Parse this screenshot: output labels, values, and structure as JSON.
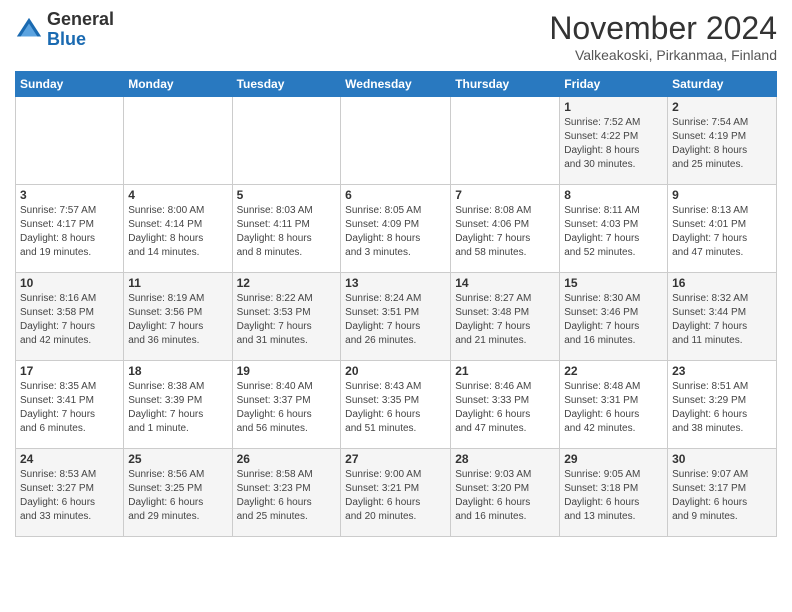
{
  "logo": {
    "general": "General",
    "blue": "Blue"
  },
  "header": {
    "month_title": "November 2024",
    "subtitle": "Valkeakoski, Pirkanmaa, Finland"
  },
  "weekdays": [
    "Sunday",
    "Monday",
    "Tuesday",
    "Wednesday",
    "Thursday",
    "Friday",
    "Saturday"
  ],
  "weeks": [
    [
      {
        "day": "",
        "detail": ""
      },
      {
        "day": "",
        "detail": ""
      },
      {
        "day": "",
        "detail": ""
      },
      {
        "day": "",
        "detail": ""
      },
      {
        "day": "",
        "detail": ""
      },
      {
        "day": "1",
        "detail": "Sunrise: 7:52 AM\nSunset: 4:22 PM\nDaylight: 8 hours\nand 30 minutes."
      },
      {
        "day": "2",
        "detail": "Sunrise: 7:54 AM\nSunset: 4:19 PM\nDaylight: 8 hours\nand 25 minutes."
      }
    ],
    [
      {
        "day": "3",
        "detail": "Sunrise: 7:57 AM\nSunset: 4:17 PM\nDaylight: 8 hours\nand 19 minutes."
      },
      {
        "day": "4",
        "detail": "Sunrise: 8:00 AM\nSunset: 4:14 PM\nDaylight: 8 hours\nand 14 minutes."
      },
      {
        "day": "5",
        "detail": "Sunrise: 8:03 AM\nSunset: 4:11 PM\nDaylight: 8 hours\nand 8 minutes."
      },
      {
        "day": "6",
        "detail": "Sunrise: 8:05 AM\nSunset: 4:09 PM\nDaylight: 8 hours\nand 3 minutes."
      },
      {
        "day": "7",
        "detail": "Sunrise: 8:08 AM\nSunset: 4:06 PM\nDaylight: 7 hours\nand 58 minutes."
      },
      {
        "day": "8",
        "detail": "Sunrise: 8:11 AM\nSunset: 4:03 PM\nDaylight: 7 hours\nand 52 minutes."
      },
      {
        "day": "9",
        "detail": "Sunrise: 8:13 AM\nSunset: 4:01 PM\nDaylight: 7 hours\nand 47 minutes."
      }
    ],
    [
      {
        "day": "10",
        "detail": "Sunrise: 8:16 AM\nSunset: 3:58 PM\nDaylight: 7 hours\nand 42 minutes."
      },
      {
        "day": "11",
        "detail": "Sunrise: 8:19 AM\nSunset: 3:56 PM\nDaylight: 7 hours\nand 36 minutes."
      },
      {
        "day": "12",
        "detail": "Sunrise: 8:22 AM\nSunset: 3:53 PM\nDaylight: 7 hours\nand 31 minutes."
      },
      {
        "day": "13",
        "detail": "Sunrise: 8:24 AM\nSunset: 3:51 PM\nDaylight: 7 hours\nand 26 minutes."
      },
      {
        "day": "14",
        "detail": "Sunrise: 8:27 AM\nSunset: 3:48 PM\nDaylight: 7 hours\nand 21 minutes."
      },
      {
        "day": "15",
        "detail": "Sunrise: 8:30 AM\nSunset: 3:46 PM\nDaylight: 7 hours\nand 16 minutes."
      },
      {
        "day": "16",
        "detail": "Sunrise: 8:32 AM\nSunset: 3:44 PM\nDaylight: 7 hours\nand 11 minutes."
      }
    ],
    [
      {
        "day": "17",
        "detail": "Sunrise: 8:35 AM\nSunset: 3:41 PM\nDaylight: 7 hours\nand 6 minutes."
      },
      {
        "day": "18",
        "detail": "Sunrise: 8:38 AM\nSunset: 3:39 PM\nDaylight: 7 hours\nand 1 minute."
      },
      {
        "day": "19",
        "detail": "Sunrise: 8:40 AM\nSunset: 3:37 PM\nDaylight: 6 hours\nand 56 minutes."
      },
      {
        "day": "20",
        "detail": "Sunrise: 8:43 AM\nSunset: 3:35 PM\nDaylight: 6 hours\nand 51 minutes."
      },
      {
        "day": "21",
        "detail": "Sunrise: 8:46 AM\nSunset: 3:33 PM\nDaylight: 6 hours\nand 47 minutes."
      },
      {
        "day": "22",
        "detail": "Sunrise: 8:48 AM\nSunset: 3:31 PM\nDaylight: 6 hours\nand 42 minutes."
      },
      {
        "day": "23",
        "detail": "Sunrise: 8:51 AM\nSunset: 3:29 PM\nDaylight: 6 hours\nand 38 minutes."
      }
    ],
    [
      {
        "day": "24",
        "detail": "Sunrise: 8:53 AM\nSunset: 3:27 PM\nDaylight: 6 hours\nand 33 minutes."
      },
      {
        "day": "25",
        "detail": "Sunrise: 8:56 AM\nSunset: 3:25 PM\nDaylight: 6 hours\nand 29 minutes."
      },
      {
        "day": "26",
        "detail": "Sunrise: 8:58 AM\nSunset: 3:23 PM\nDaylight: 6 hours\nand 25 minutes."
      },
      {
        "day": "27",
        "detail": "Sunrise: 9:00 AM\nSunset: 3:21 PM\nDaylight: 6 hours\nand 20 minutes."
      },
      {
        "day": "28",
        "detail": "Sunrise: 9:03 AM\nSunset: 3:20 PM\nDaylight: 6 hours\nand 16 minutes."
      },
      {
        "day": "29",
        "detail": "Sunrise: 9:05 AM\nSunset: 3:18 PM\nDaylight: 6 hours\nand 13 minutes."
      },
      {
        "day": "30",
        "detail": "Sunrise: 9:07 AM\nSunset: 3:17 PM\nDaylight: 6 hours\nand 9 minutes."
      }
    ]
  ]
}
